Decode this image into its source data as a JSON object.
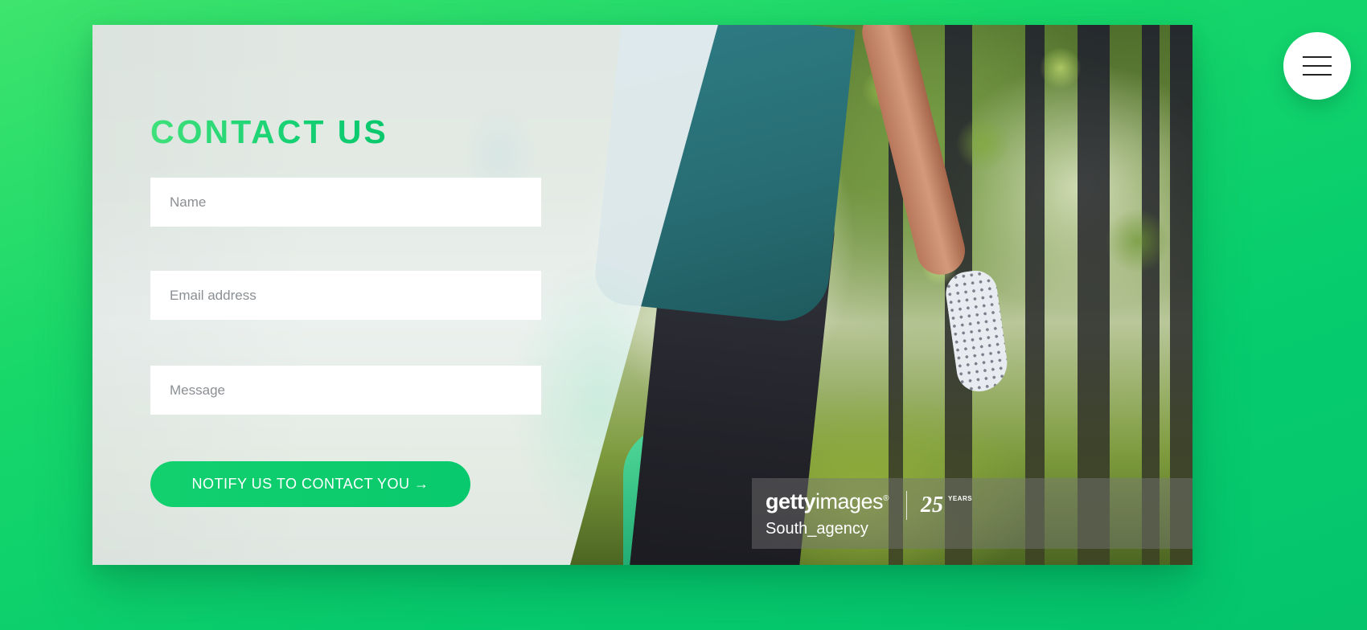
{
  "contact": {
    "title": "CONTACT US",
    "name_placeholder": "Name",
    "email_placeholder": "Email address",
    "message_placeholder": "Message",
    "submit_label": "NOTIFY US TO CONTACT YOU →"
  },
  "watermark": {
    "brand_bold": "getty",
    "brand_light": "images",
    "brand_mark": "®",
    "years": "25",
    "years_label": "YEARS",
    "credit": "South_agency"
  },
  "menu": {
    "icon": "hamburger-menu-icon"
  },
  "colors": {
    "accent_green": "#08c96d",
    "background_green": "#17d76a",
    "panel": "#f1f5f7",
    "text_on_accent": "#ffffff"
  }
}
